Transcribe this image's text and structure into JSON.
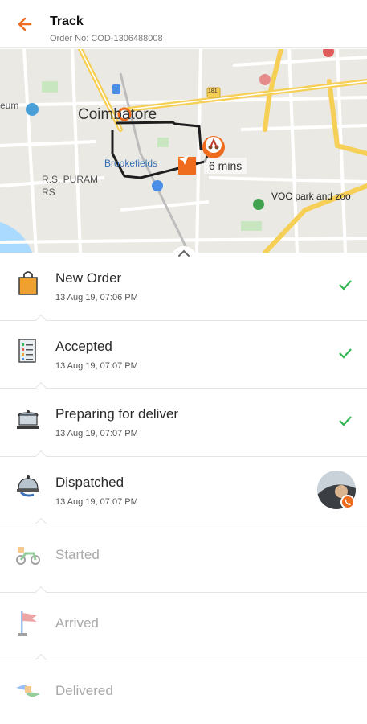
{
  "header": {
    "title": "Track",
    "order_label": "Order No: COD-1306488008"
  },
  "map": {
    "city": "Coimbatore",
    "areas": [
      "eum",
      "R.S. PURAM",
      "RS",
      "Brookefields"
    ],
    "road_number": "181",
    "poi": "VOC park and zoo",
    "eta": "6 mins"
  },
  "steps": [
    {
      "title": "New Order",
      "time": "13 Aug 19, 07:06 PM",
      "done": true,
      "icon": "shopping-bag-icon"
    },
    {
      "title": "Accepted",
      "time": "13 Aug 19, 07:07 PM",
      "done": true,
      "icon": "checklist-icon"
    },
    {
      "title": "Preparing for deliver",
      "time": "13 Aug 19, 07:07 PM",
      "done": true,
      "icon": "cooking-pot-icon"
    },
    {
      "title": "Dispatched",
      "time": "13 Aug 19, 07:07 PM",
      "done": false,
      "icon": "food-cloche-icon"
    },
    {
      "title": "Started",
      "time": "",
      "done": false,
      "icon": "scooter-icon"
    },
    {
      "title": "Arrived",
      "time": "",
      "done": false,
      "icon": "flag-icon"
    },
    {
      "title": "Delivered",
      "time": "",
      "done": false,
      "icon": "handover-icon"
    }
  ],
  "colors": {
    "accent": "#ef6c1f",
    "check": "#2fb552",
    "route": "#1e1e1e",
    "road_major": "#f6cf57"
  }
}
